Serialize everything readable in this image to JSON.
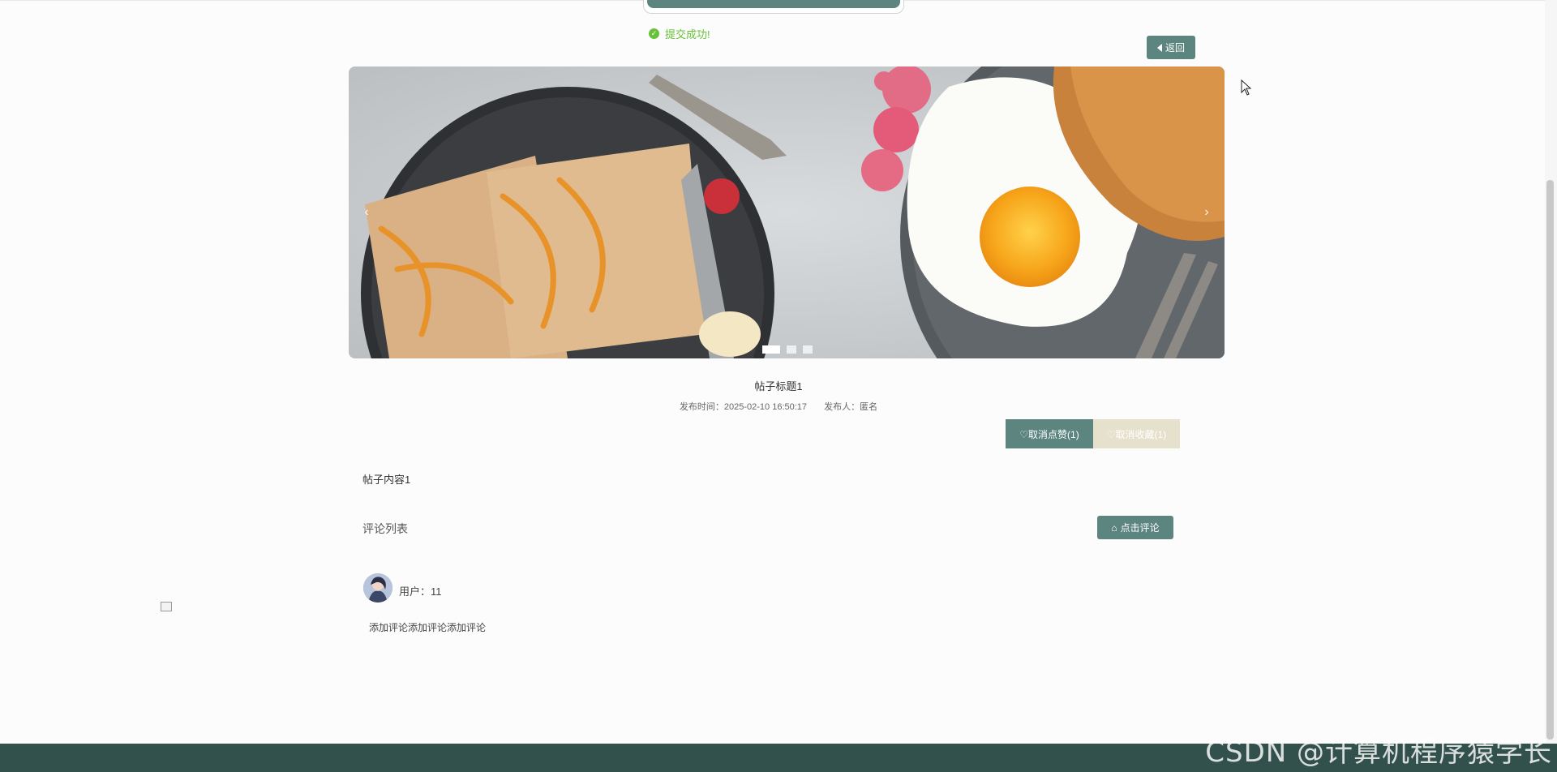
{
  "toast": {
    "message": "提交成功!"
  },
  "nav": {
    "back_label": "返回"
  },
  "carousel": {
    "prev_label": "‹",
    "next_label": "›",
    "slides": 3,
    "active_slide": 0
  },
  "post": {
    "title": "帖子标题1",
    "publish_time": "发布时间：2025-02-10 16:50:17",
    "publisher": "发布人：匿名",
    "content": "帖子内容1"
  },
  "actions": {
    "like_label": "♡取消点赞(1)",
    "favorite_label": "♡取消收藏(1)"
  },
  "comments": {
    "heading": "评论列表",
    "add_label": "点击评论",
    "items": [
      {
        "user": "用户：11",
        "text": "添加评论添加评论添加评论"
      }
    ]
  },
  "watermark": "CSDN @计算机程序猿学长",
  "colors": {
    "primary": "#5b857e",
    "favorite_bg": "#e6e1cd",
    "footer": "#33514c",
    "success": "#67c23a"
  }
}
